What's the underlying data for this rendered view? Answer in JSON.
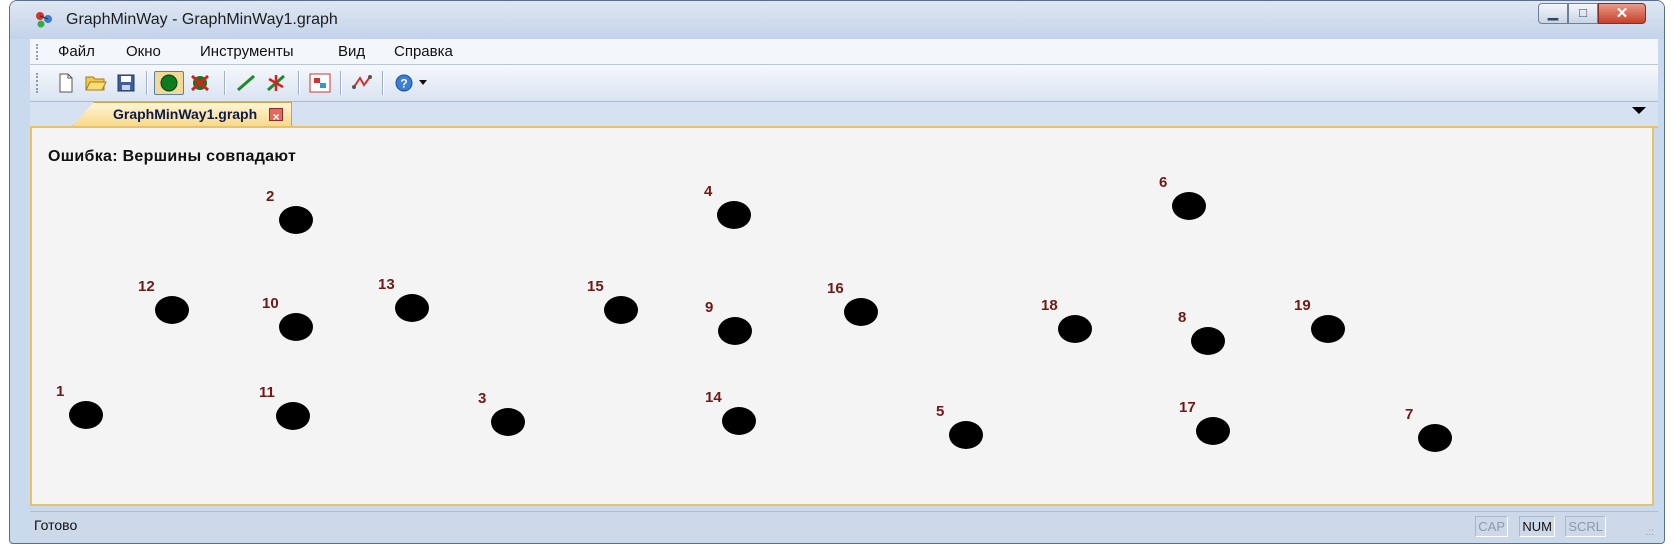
{
  "window": {
    "title": "GraphMinWay - GraphMinWay1.graph"
  },
  "menu": [
    "Файл",
    "Окно",
    "Инструменты",
    "Вид",
    "Справка"
  ],
  "toolbar": {
    "buttons": [
      {
        "name": "new-file-icon"
      },
      {
        "name": "open-folder-icon"
      },
      {
        "name": "save-icon"
      },
      {
        "name": "add-vertex-icon",
        "pressed": true
      },
      {
        "name": "delete-vertex-icon"
      },
      {
        "name": "add-edge-icon"
      },
      {
        "name": "delete-edge-icon"
      },
      {
        "name": "matrix-icon"
      },
      {
        "name": "shortest-path-icon"
      },
      {
        "name": "help-icon"
      }
    ]
  },
  "tab": {
    "label": "GraphMinWay1.graph"
  },
  "canvas": {
    "error": "Ошибка: Вершины совпадают"
  },
  "vertices": [
    {
      "id": "1"
    },
    {
      "id": "2"
    },
    {
      "id": "3"
    },
    {
      "id": "4"
    },
    {
      "id": "5"
    },
    {
      "id": "6"
    },
    {
      "id": "7"
    },
    {
      "id": "8"
    },
    {
      "id": "9"
    },
    {
      "id": "10"
    },
    {
      "id": "11"
    },
    {
      "id": "12"
    },
    {
      "id": "13"
    },
    {
      "id": "14"
    },
    {
      "id": "15"
    },
    {
      "id": "16"
    },
    {
      "id": "17"
    },
    {
      "id": "18"
    },
    {
      "id": "19"
    }
  ],
  "status": {
    "text": "Готово",
    "indicators": [
      {
        "label": "CAP",
        "on": false
      },
      {
        "label": "NUM",
        "on": true
      },
      {
        "label": "SCRL",
        "on": false
      }
    ]
  },
  "colors": {
    "vertex": "#000000",
    "vertex_label": "#6e1a16",
    "tab_accent": "#e6c26a"
  }
}
